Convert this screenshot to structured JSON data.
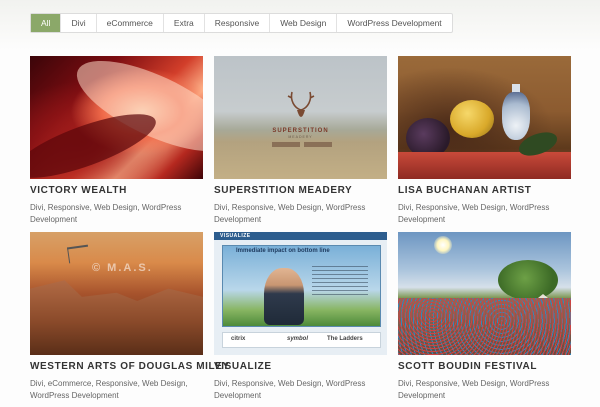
{
  "filters": [
    "All",
    "Divi",
    "eCommerce",
    "Extra",
    "Responsive",
    "Web Design",
    "WordPress Development"
  ],
  "active_filter": "All",
  "accent_color": "#8ba869",
  "projects": [
    {
      "title": "VICTORY WEALTH",
      "categories": "Divi, Responsive, Web Design, WordPress Development"
    },
    {
      "title": "SUPERSTITION MEADERY",
      "categories": "Divi, Responsive, Web Design, WordPress Development",
      "thumb_text": "SUPERSTITION",
      "thumb_subtext": "MEADERY"
    },
    {
      "title": "LISA BUCHANAN ARTIST",
      "categories": "Divi, Responsive, Web Design, WordPress Development"
    },
    {
      "title": "WESTERN ARTS OF DOUGLAS MILEY",
      "categories": "Divi, eCommerce, Responsive, Web Design, WordPress Development",
      "thumb_text": "© M.A.S."
    },
    {
      "title": "VISUALIZE",
      "categories": "Divi, Responsive, Web Design, WordPress Development",
      "thumb_text": "VISUALIZE",
      "thumb_headline": "Immediate impact on bottom line",
      "thumb_logos": [
        "citrix",
        "symbol",
        "The Ladders"
      ]
    },
    {
      "title": "SCOTT BOUDIN FESTIVAL",
      "categories": "Divi, Responsive, Web Design, WordPress Development"
    }
  ]
}
